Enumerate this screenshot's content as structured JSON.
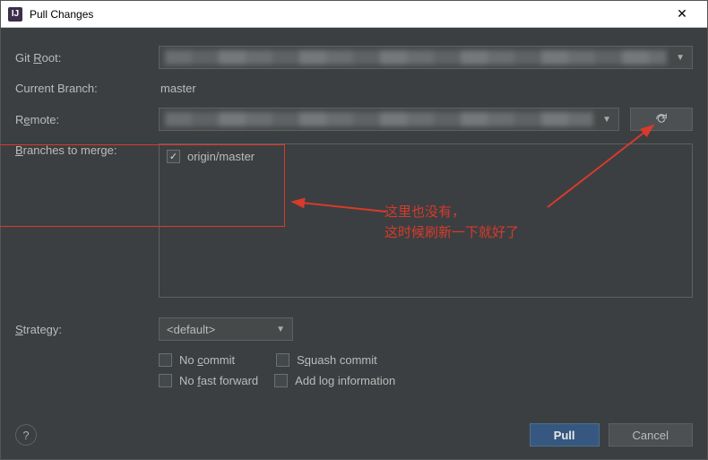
{
  "window": {
    "title": "Pull Changes",
    "app_icon_letter": "IJ"
  },
  "labels": {
    "git_root_pre": "Git ",
    "git_root_u": "R",
    "git_root_post": "oot:",
    "current_branch": "Current Branch:",
    "remote_pre": "R",
    "remote_u": "e",
    "remote_post": "mote:",
    "branches_u": "B",
    "branches_post": "ranches to merge:",
    "strategy_u": "S",
    "strategy_post": "trategy:"
  },
  "values": {
    "current_branch": "master",
    "branch_item": "origin/master",
    "strategy": "<default>"
  },
  "options": {
    "no_commit_pre": "No ",
    "no_commit_u": "c",
    "no_commit_post": "ommit",
    "squash_pre": "S",
    "squash_u": "q",
    "squash_post": "uash commit",
    "no_ff_pre": "No ",
    "no_ff_u": "f",
    "no_ff_post": "ast forward",
    "add_log_pre": "Add lo",
    "add_log_u": "g",
    "add_log_post": " information"
  },
  "buttons": {
    "pull": "Pull",
    "cancel": "Cancel",
    "help": "?"
  },
  "annotation": {
    "line1": "这里也没有，",
    "line2": "这时候刷新一下就好了"
  }
}
